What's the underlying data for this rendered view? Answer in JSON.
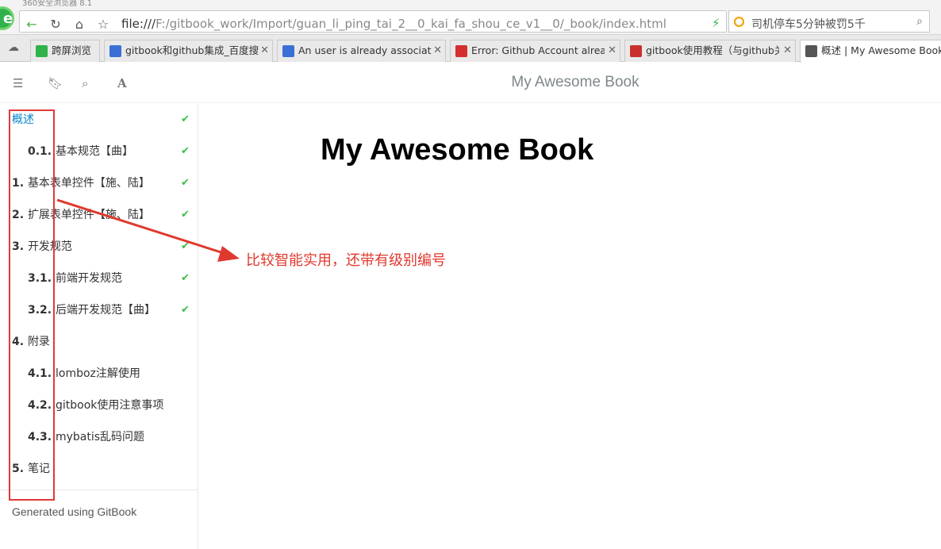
{
  "browser": {
    "window_title": "360安全浏览器 8.1",
    "url_scheme": "file:///",
    "url_path": "F:/gitbook_work/Import/guan_li_ping_tai_2__0_kai_fa_shou_ce_v1__0/_book/index.html",
    "search_text": "司机停车5分钟被罚5千",
    "tabs": [
      {
        "label": "跨屏浏览",
        "color": "#2fb24a"
      },
      {
        "label": "gitbook和github集成_百度搜索",
        "color": "#3b6fd6"
      },
      {
        "label": "An user is already associated",
        "color": "#3b6fd6"
      },
      {
        "label": "Error: Github Account already",
        "color": "#d32f2f"
      },
      {
        "label": "gitbook使用教程（与github关",
        "color": "#c9302c"
      },
      {
        "label": "概述 | My Awesome Book",
        "color": "#555555"
      }
    ]
  },
  "book": {
    "header_title": "My Awesome Book",
    "page_heading": "My Awesome Book",
    "footer": "Generated using GitBook",
    "summary": [
      {
        "num": "",
        "label": "概述",
        "checked": true,
        "indent": 0,
        "active": true
      },
      {
        "num": "0.1.",
        "label": "基本规范【曲】",
        "checked": true,
        "indent": 1
      },
      {
        "num": "1.",
        "label": "基本表单控件【施、陆】",
        "checked": true,
        "indent": 0
      },
      {
        "num": "2.",
        "label": "扩展表单控件【施、陆】",
        "checked": true,
        "indent": 0
      },
      {
        "num": "3.",
        "label": "开发规范",
        "checked": true,
        "indent": 0
      },
      {
        "num": "3.1.",
        "label": "前端开发规范",
        "checked": true,
        "indent": 1
      },
      {
        "num": "3.2.",
        "label": "后端开发规范【曲】",
        "checked": true,
        "indent": 1
      },
      {
        "num": "4.",
        "label": "附录",
        "checked": false,
        "indent": 0
      },
      {
        "num": "4.1.",
        "label": "lomboz注解使用",
        "checked": false,
        "indent": 1
      },
      {
        "num": "4.2.",
        "label": "gitbook使用注意事项",
        "checked": false,
        "indent": 1
      },
      {
        "num": "4.3.",
        "label": "mybatis乱码问题",
        "checked": false,
        "indent": 1
      },
      {
        "num": "5.",
        "label": "笔记",
        "checked": false,
        "indent": 0
      }
    ]
  },
  "annotation": {
    "text": "比较智能实用，还带有级别编号",
    "color": "#e0392e"
  }
}
